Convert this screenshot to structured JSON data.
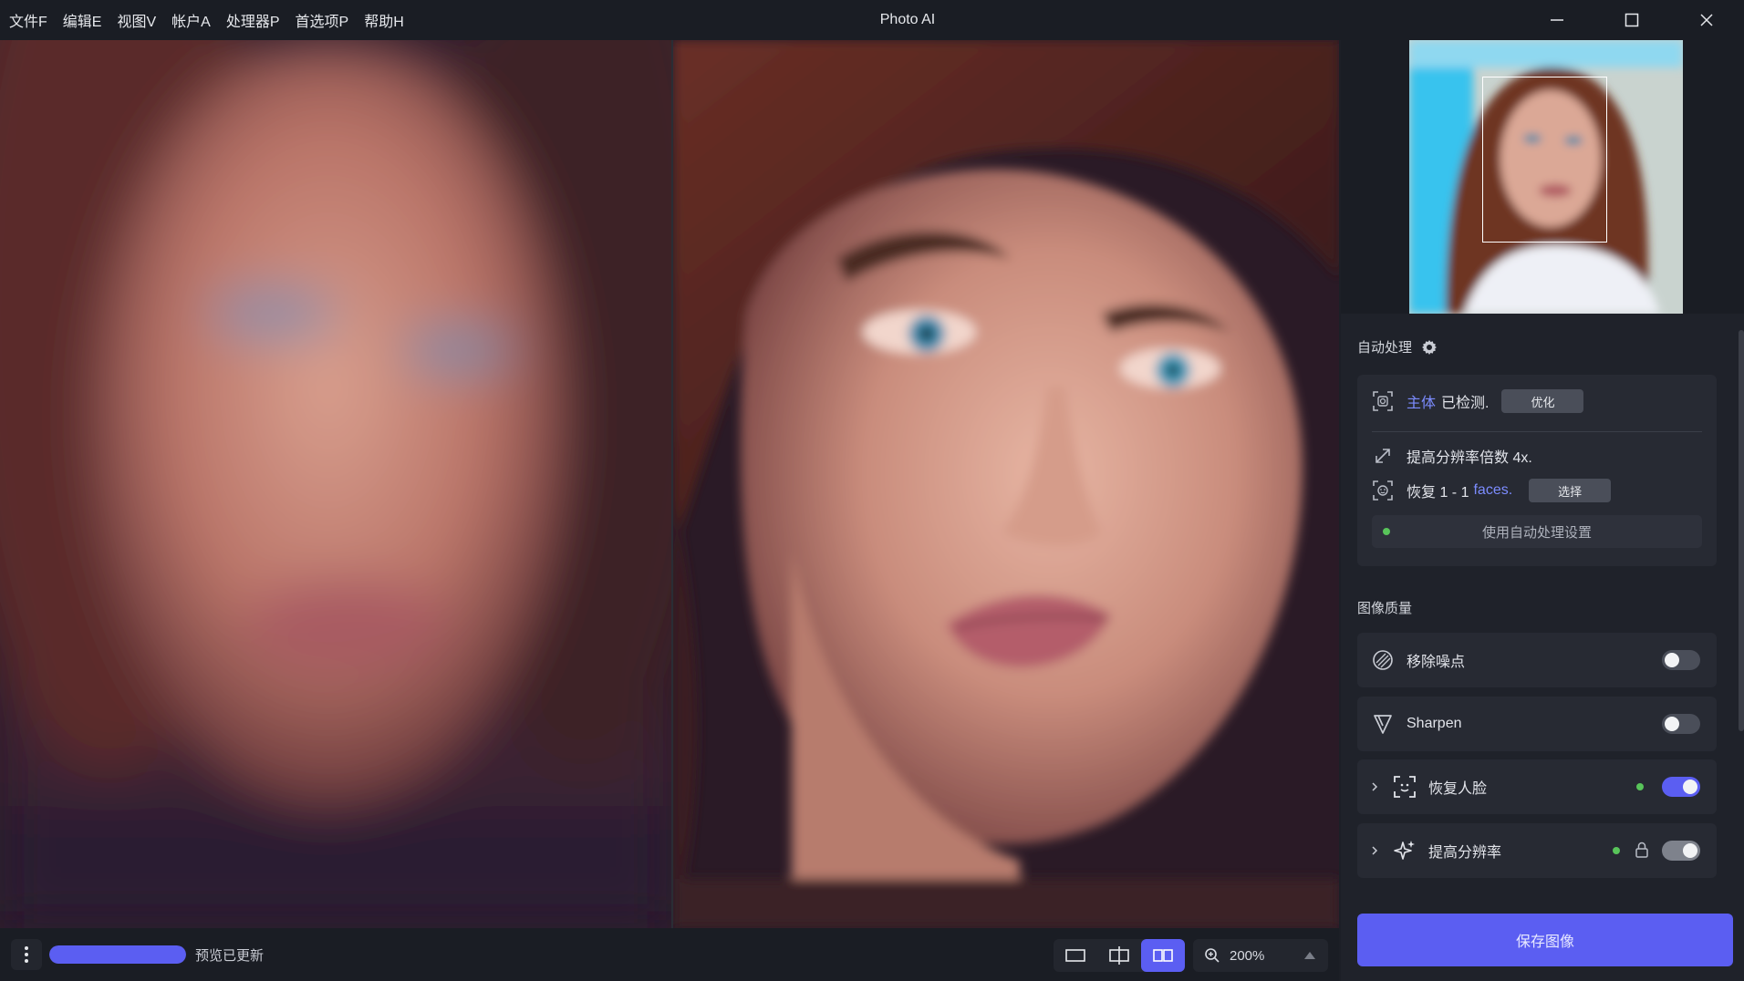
{
  "window": {
    "title": "Photo AI",
    "menu": [
      "文件F",
      "编辑E",
      "视图V",
      "帐户A",
      "处理器P",
      "首选项P",
      "帮助H"
    ],
    "controls": [
      "minimize-icon",
      "maximize-icon",
      "close-icon"
    ]
  },
  "status": {
    "progress_fraction": 1.0,
    "text": "预览已更新"
  },
  "view_modes": {
    "items": [
      "single-view-icon",
      "split-view-icon",
      "side-by-side-view-icon"
    ],
    "active_index": 2
  },
  "zoom": {
    "value": "200%"
  },
  "autopilot": {
    "title": "自动处理",
    "subject_label": "主体",
    "subject_status": "已检测.",
    "optimize_button": "优化",
    "upscale_text": "提高分辨率倍数 4x.",
    "faces_prefix": "恢复 1 - 1",
    "faces_word": "faces.",
    "select_button": "选择",
    "use_settings_button": "使用自动处理设置"
  },
  "quality": {
    "title": "图像质量",
    "items": [
      {
        "label": "移除噪点",
        "icon": "denoise-icon",
        "enabled": false,
        "expandable": false,
        "applied": false,
        "locked": false
      },
      {
        "label": "Sharpen",
        "icon": "sharpen-icon",
        "enabled": false,
        "expandable": false,
        "applied": false,
        "locked": false
      },
      {
        "label": "恢复人脸",
        "icon": "face-recovery-icon",
        "enabled": true,
        "expandable": true,
        "applied": true,
        "locked": false
      },
      {
        "label": "提高分辨率",
        "icon": "upscale-sparkle-icon",
        "enabled": true,
        "expandable": true,
        "applied": true,
        "locked": true
      }
    ]
  },
  "save_button": "保存图像",
  "colors": {
    "accent": "#5b5ef2",
    "applied_dot": "#58c45a",
    "link": "#7c8cff"
  }
}
